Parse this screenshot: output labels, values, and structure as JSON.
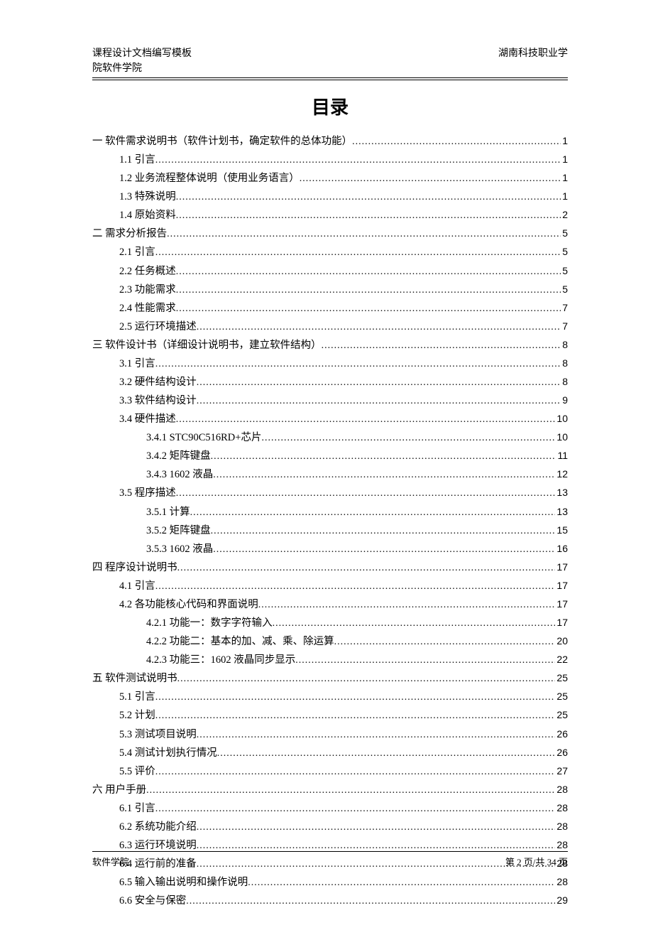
{
  "header": {
    "left_line1": "课程设计文档编写模板",
    "left_line2": "院软件学院",
    "right": "湖南科技职业学"
  },
  "title": "目录",
  "toc": [
    {
      "level": 0,
      "label": "一 软件需求说明书（软件计划书，确定软件的总体功能）",
      "page": "1"
    },
    {
      "level": 1,
      "label": "1.1 引言",
      "page": "1"
    },
    {
      "level": 1,
      "label": "1.2 业务流程整体说明（使用业务语言）",
      "page": "1"
    },
    {
      "level": 1,
      "label": "1.3 特殊说明",
      "page": "1"
    },
    {
      "level": 1,
      "label": "1.4 原始资料",
      "page": "2"
    },
    {
      "level": 0,
      "label": "二 需求分析报告",
      "page": "5"
    },
    {
      "level": 1,
      "label": "2.1 引言",
      "page": "5"
    },
    {
      "level": 1,
      "label": "2.2 任务概述",
      "page": "5"
    },
    {
      "level": 1,
      "label": "2.3 功能需求",
      "page": "5"
    },
    {
      "level": 1,
      "label": "2.4 性能需求",
      "page": "7"
    },
    {
      "level": 1,
      "label": "2.5 运行环境描述",
      "page": "7"
    },
    {
      "level": 0,
      "label": "三 软件设计书（详细设计说明书，建立软件结构）",
      "page": "8"
    },
    {
      "level": 1,
      "label": "3.1 引言",
      "page": "8"
    },
    {
      "level": 1,
      "label": "3.2 硬件结构设计",
      "page": "8"
    },
    {
      "level": 1,
      "label": "3.3 软件结构设计",
      "page": "9"
    },
    {
      "level": 1,
      "label": "3.4 硬件描述",
      "page": "10"
    },
    {
      "level": 2,
      "label": "3.4.1 STC90C516RD+芯片",
      "page": "10"
    },
    {
      "level": 2,
      "label": "3.4.2 矩阵键盘",
      "page": "11"
    },
    {
      "level": 2,
      "label": "3.4.3 1602 液晶",
      "page": "12"
    },
    {
      "level": 1,
      "label": "3.5 程序描述",
      "page": "13"
    },
    {
      "level": 2,
      "label": "3.5.1 计算",
      "page": "13"
    },
    {
      "level": 2,
      "label": "3.5.2 矩阵键盘",
      "page": "15"
    },
    {
      "level": 2,
      "label": "3.5.3 1602 液晶",
      "page": "16"
    },
    {
      "level": 0,
      "label": "四 程序设计说明书",
      "page": "17"
    },
    {
      "level": 1,
      "label": "4.1 引言",
      "page": "17"
    },
    {
      "level": 1,
      "label": "4.2 各功能核心代码和界面说明",
      "page": "17"
    },
    {
      "level": 2,
      "label": "4.2.1 功能一：数字字符输入",
      "page": "17"
    },
    {
      "level": 2,
      "label": "4.2.2 功能二：基本的加、减、乘、除运算",
      "page": "20"
    },
    {
      "level": 2,
      "label": "4.2.3 功能三：1602 液晶同步显示",
      "page": "22"
    },
    {
      "level": 0,
      "label": "五 软件测试说明书",
      "page": "25"
    },
    {
      "level": 1,
      "label": "5.1 引言",
      "page": "25"
    },
    {
      "level": 1,
      "label": "5.2 计划",
      "page": "25"
    },
    {
      "level": 1,
      "label": "5.3 测试项目说明",
      "page": "26"
    },
    {
      "level": 1,
      "label": "5.4 测试计划执行情况",
      "page": "26"
    },
    {
      "level": 1,
      "label": "5.5 评价",
      "page": "27"
    },
    {
      "level": 0,
      "label": "六 用户手册",
      "page": "28"
    },
    {
      "level": 1,
      "label": "6.1 引言",
      "page": "28"
    },
    {
      "level": 1,
      "label": "6.2 系统功能介绍",
      "page": "28"
    },
    {
      "level": 1,
      "label": "6.3 运行环境说明",
      "page": "28"
    },
    {
      "level": 1,
      "label": "6.4 运行前的准备",
      "page": "28"
    },
    {
      "level": 1,
      "label": "6.5 输入输出说明和操作说明",
      "page": "28"
    },
    {
      "level": 1,
      "label": "6.6 安全与保密",
      "page": "29"
    }
  ],
  "footer": {
    "left": "软件学院",
    "right": "第 2 页/共 34 页"
  }
}
